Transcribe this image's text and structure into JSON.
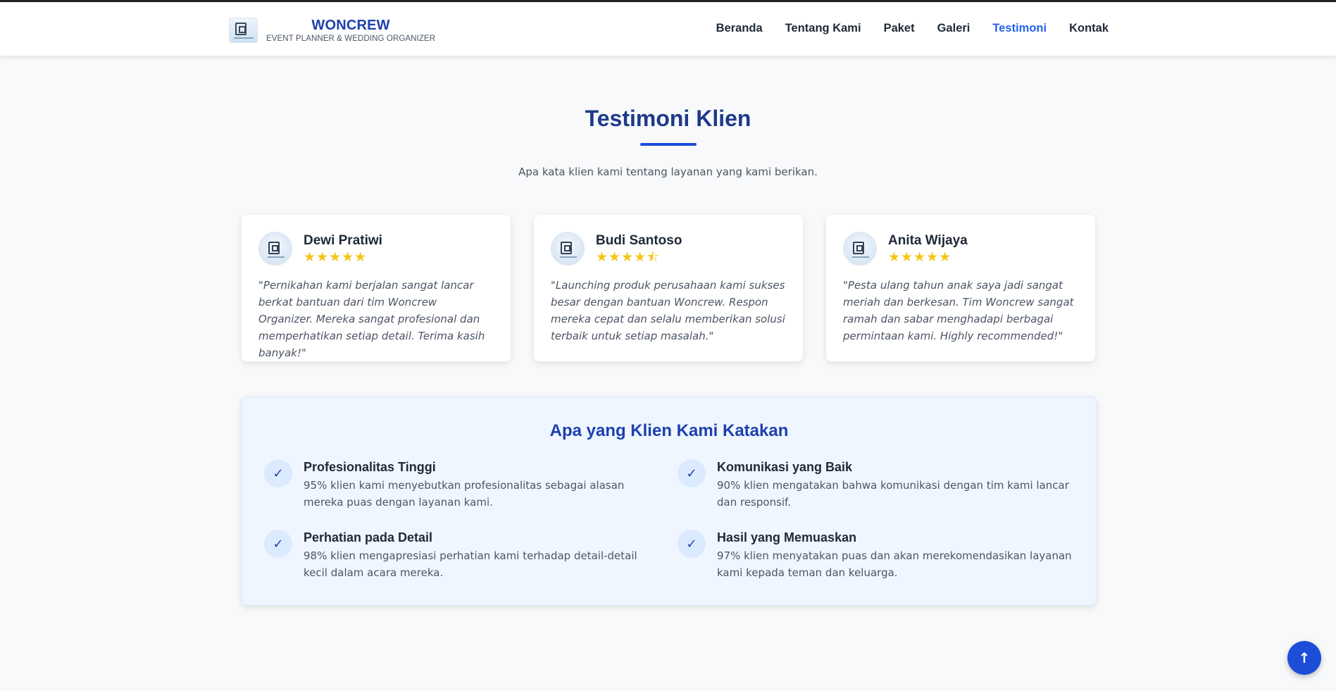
{
  "brand": {
    "name": "WONCREW",
    "tagline": "EVENT PLANNER & WEDDING ORGANIZER"
  },
  "nav": {
    "items": [
      {
        "label": "Beranda"
      },
      {
        "label": "Tentang Kami"
      },
      {
        "label": "Paket"
      },
      {
        "label": "Galeri"
      },
      {
        "label": "Testimoni",
        "active": true
      },
      {
        "label": "Kontak"
      }
    ]
  },
  "section": {
    "title": "Testimoni Klien",
    "subtitle": "Apa kata klien kami tentang layanan yang kami berikan."
  },
  "testimonials": [
    {
      "name": "Dewi Pratiwi",
      "rating": 5,
      "stars": "★★★★★",
      "quote": "\"Pernikahan kami berjalan sangat lancar berkat bantuan dari tim Woncrew Organizer. Mereka sangat profesional dan memperhatikan setiap detail. Terima kasih banyak!\""
    },
    {
      "name": "Budi Santoso",
      "rating": 4.5,
      "stars": "★★★★⯪",
      "quote": "\"Launching produk perusahaan kami sukses besar dengan bantuan Woncrew. Respon mereka cepat dan selalu memberikan solusi terbaik untuk setiap masalah.\""
    },
    {
      "name": "Anita Wijaya",
      "rating": 5,
      "stars": "★★★★★",
      "quote": "\"Pesta ulang tahun anak saya jadi sangat meriah dan berkesan. Tim Woncrew sangat ramah dan sabar menghadapi berbagai permintaan kami. Highly recommended!\""
    }
  ],
  "reasons": {
    "title": "Apa yang Klien Kami Katakan",
    "check_glyph": "✓",
    "items": [
      {
        "title": "Profesionalitas Tinggi",
        "text": "95% klien kami menyebutkan profesionalitas sebagai alasan mereka puas dengan layanan kami."
      },
      {
        "title": "Komunikasi yang Baik",
        "text": "90% klien mengatakan bahwa komunikasi dengan tim kami lancar dan responsif."
      },
      {
        "title": "Perhatian pada Detail",
        "text": "98% klien mengapresiasi perhatian kami terhadap detail-detail kecil dalam acara mereka."
      },
      {
        "title": "Hasil yang Memuaskan",
        "text": "97% klien menyatakan puas dan akan merekomendasikan layanan kami kepada teman dan keluarga."
      }
    ]
  },
  "back_to_top": {
    "glyph": "↑"
  },
  "colors": {
    "accent": "#1d4ed8",
    "heading": "#1e3a8a",
    "star": "#f5c518",
    "panel": "#eff6ff"
  }
}
